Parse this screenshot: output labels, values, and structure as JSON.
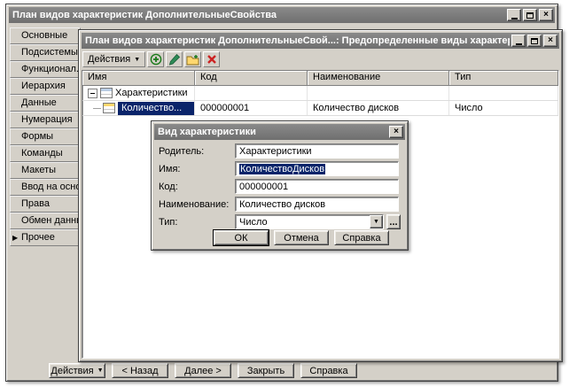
{
  "colors": {
    "selection": "#0a246a",
    "titlebar": "#7a7a7a",
    "chrome": "#d4d0c8",
    "add_green": "#1a7a1a",
    "delete_red": "#cc2222"
  },
  "main_window": {
    "title": "План видов характеристик ДополнительныеСвойства",
    "tabs": [
      "Основные",
      "Подсистемы",
      "Функционал...",
      "Иерархия",
      "Данные",
      "Нумерация",
      "Формы",
      "Команды",
      "Макеты",
      "Ввод на осно...",
      "Права",
      "Обмен данны...",
      "Прочее"
    ],
    "selected_tab": "Прочее",
    "bottom_buttons": {
      "actions": "Действия",
      "back": "< Назад",
      "next": "Далее >",
      "close": "Закрыть",
      "help": "Справка"
    }
  },
  "list_window": {
    "title": "План видов характеристик ДополнительныеСвой...: Предопределенные виды характеристик",
    "toolbar": {
      "actions_label": "Действия"
    },
    "table": {
      "columns": [
        "Имя",
        "Код",
        "Наименование",
        "Тип"
      ],
      "group_row": {
        "name": "Характеристики"
      },
      "row": {
        "name": "Количество...",
        "code": "000000001",
        "description": "Количество дисков",
        "type": "Число"
      }
    }
  },
  "dialog": {
    "title": "Вид характеристики",
    "fields": {
      "parent": {
        "label": "Родитель:",
        "value": "Характеристики"
      },
      "name": {
        "label": "Имя:",
        "value": "КоличествоДисков"
      },
      "code": {
        "label": "Код:",
        "value": "000000001"
      },
      "description": {
        "label": "Наименование:",
        "value": "Количество дисков"
      },
      "type": {
        "label": "Тип:",
        "value": "Число"
      }
    },
    "dots_button": "...",
    "buttons": {
      "ok": "ОК",
      "cancel": "Отмена",
      "help": "Справка"
    }
  }
}
